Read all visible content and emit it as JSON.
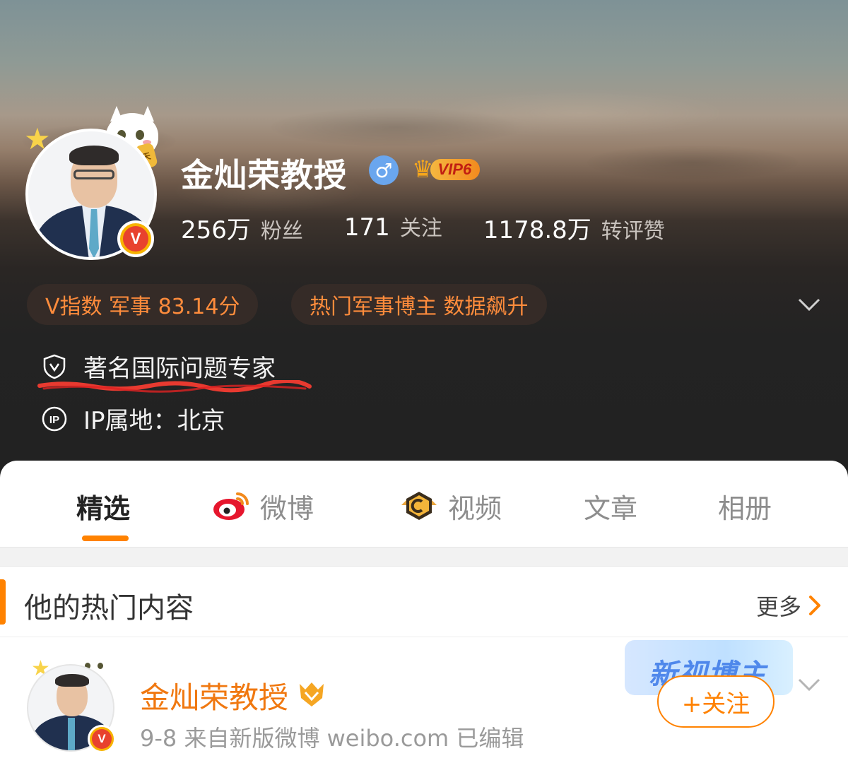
{
  "profile": {
    "name": "金灿荣教授",
    "gender_symbol": "♂",
    "vip_label": "VIP6",
    "avatar_badge": "V",
    "stats": [
      {
        "value": "256万",
        "label": "粉丝"
      },
      {
        "value": "171",
        "label": "关注"
      },
      {
        "value": "1178.8万",
        "label": "转评赞"
      }
    ],
    "pills": [
      "V指数 军事 83.14分",
      "热门军事博主 数据飙升"
    ],
    "verification": "著名国际问题专家",
    "ip_location": "IP属地：北京",
    "cat_tag": "天天向上"
  },
  "tabs": [
    {
      "label": "精选",
      "active": true
    },
    {
      "label": "微博",
      "icon": "weibo-icon"
    },
    {
      "label": "视频",
      "icon": "video-icon"
    },
    {
      "label": "文章"
    },
    {
      "label": "相册"
    }
  ],
  "hot_section": {
    "title": "他的热门内容",
    "more_label": "更多"
  },
  "post": {
    "author": "金灿荣教授",
    "meta": "9-8  来自新版微博 weibo.com  已编辑",
    "banner_text": "新视博主",
    "follow_label": "+关注"
  },
  "colors": {
    "accent": "#ff8200",
    "pill_text": "#ff8c3c",
    "author_name": "#f07810",
    "gender_blue": "#6aa6ee"
  }
}
